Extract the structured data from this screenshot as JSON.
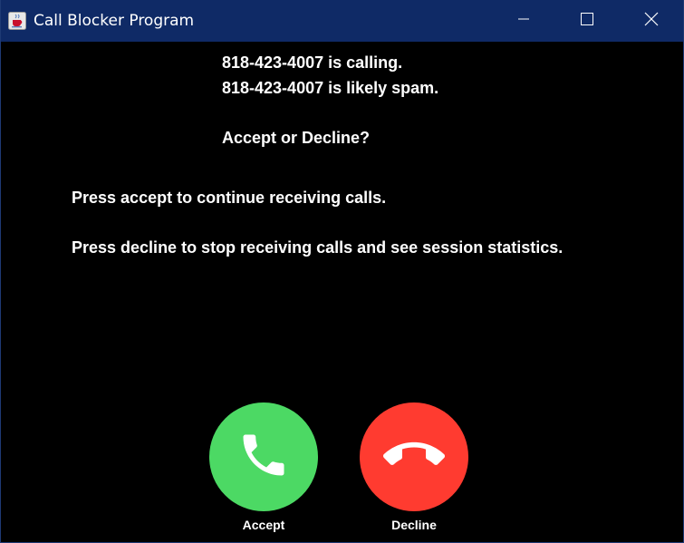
{
  "window": {
    "title": "Call Blocker Program",
    "title_bar_color": "#0f2a66",
    "app_icon": "java-cup-icon",
    "controls": {
      "minimize_icon": "minimize-icon",
      "maximize_icon": "maximize-icon",
      "close_icon": "close-icon"
    }
  },
  "message": {
    "line1": "818-423-4007 is calling.",
    "line2": "818-423-4007 is likely spam.",
    "prompt": "Accept or Decline?",
    "accept_hint": "Press accept to continue receiving calls.",
    "decline_hint": "Press decline to stop receiving calls and see session statistics."
  },
  "actions": {
    "accept": {
      "label": "Accept",
      "color": "#4cd964",
      "icon": "phone-icon"
    },
    "decline": {
      "label": "Decline",
      "color": "#ff3b30",
      "icon": "phone-hangup-icon"
    }
  }
}
